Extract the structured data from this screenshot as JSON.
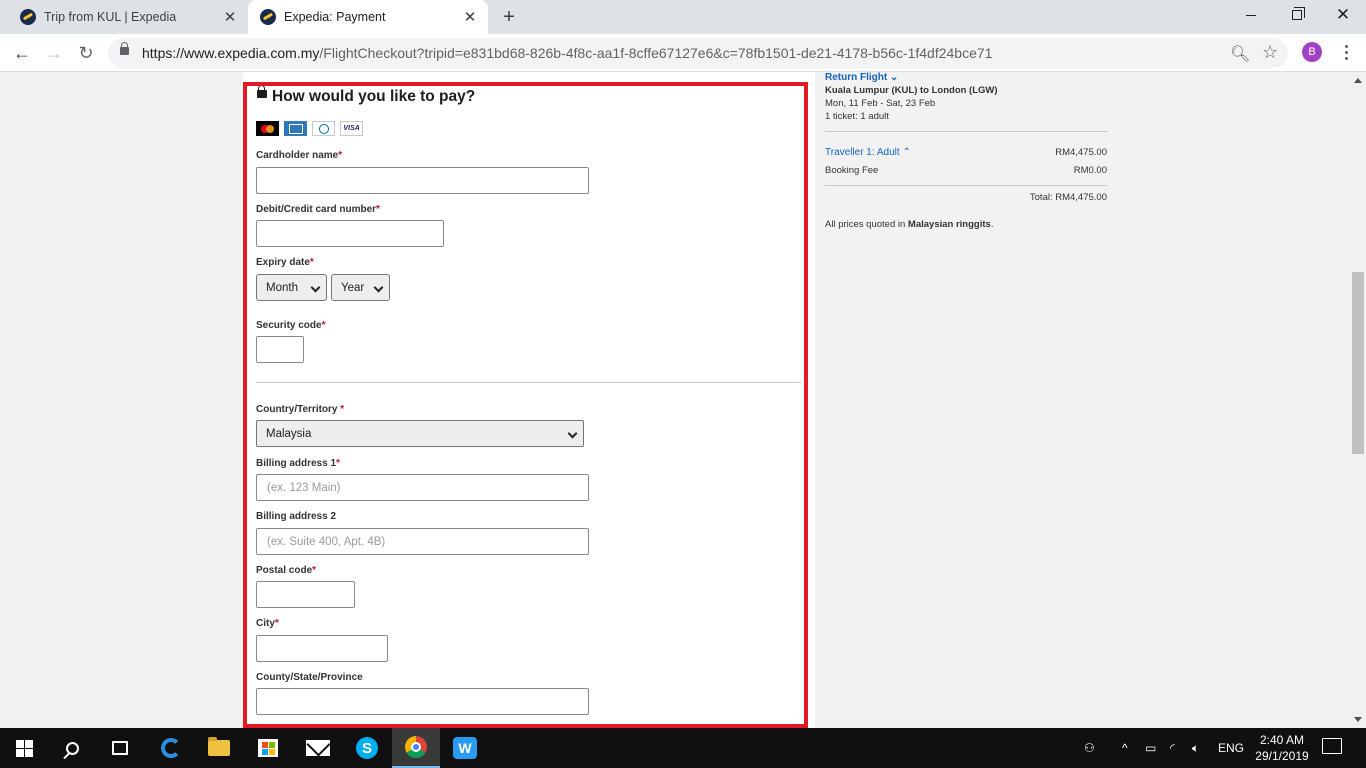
{
  "browser": {
    "tabs": [
      {
        "title": "Trip from KUL | Expedia",
        "active": false
      },
      {
        "title": "Expedia: Payment",
        "active": true
      }
    ],
    "url_host": "https://www.expedia.com.my",
    "url_path": "/FlightCheckout?tripid=e831bd68-826b-4f8c-aa1f-8cffe67127e6&c=78fb1501-de21-4178-b56c-1f4df24bce71",
    "profile_initial": "B"
  },
  "payment": {
    "title": "How would you like to pay?",
    "card_brands": [
      "mastercard",
      "amex",
      "diners-club",
      "visa"
    ],
    "visa_text": "VISA",
    "required_mark": "*",
    "cardholder_label": "Cardholder name",
    "card_number_label": "Debit/Credit card number",
    "expiry_label": "Expiry date",
    "month_select": "Month",
    "year_select": "Year",
    "security_label": "Security code",
    "country_label": "Country/Territory",
    "country_value": "Malaysia",
    "billing1_label": "Billing address 1",
    "billing1_placeholder": "(ex. 123 Main)",
    "billing2_label": "Billing address 2",
    "billing2_placeholder": "(ex. Suite 400, Apt. 4B)",
    "postal_label": "Postal code",
    "city_label": "City",
    "county_label": "County/State/Province"
  },
  "summary": {
    "return_flight": "Return Flight",
    "route": "Kuala Lumpur (KUL) to London (LGW)",
    "dates": "Mon, 11 Feb - Sat, 23 Feb",
    "tickets": "1 ticket: 1 adult",
    "traveller_label": "Traveller 1: Adult",
    "traveller_price": "RM4,475.00",
    "booking_fee_label": "Booking Fee",
    "booking_fee_price": "RM0.00",
    "total": "Total: RM4,475.00",
    "currency_note_prefix": "All prices quoted in ",
    "currency_note_bold": "Malaysian ringgits",
    "currency_note_suffix": "."
  },
  "taskbar": {
    "language": "ENG",
    "time": "2:40 AM",
    "date": "29/1/2019"
  },
  "colors": {
    "highlight": "#e21a25",
    "link": "#1565c0",
    "required": "#c8102e"
  }
}
